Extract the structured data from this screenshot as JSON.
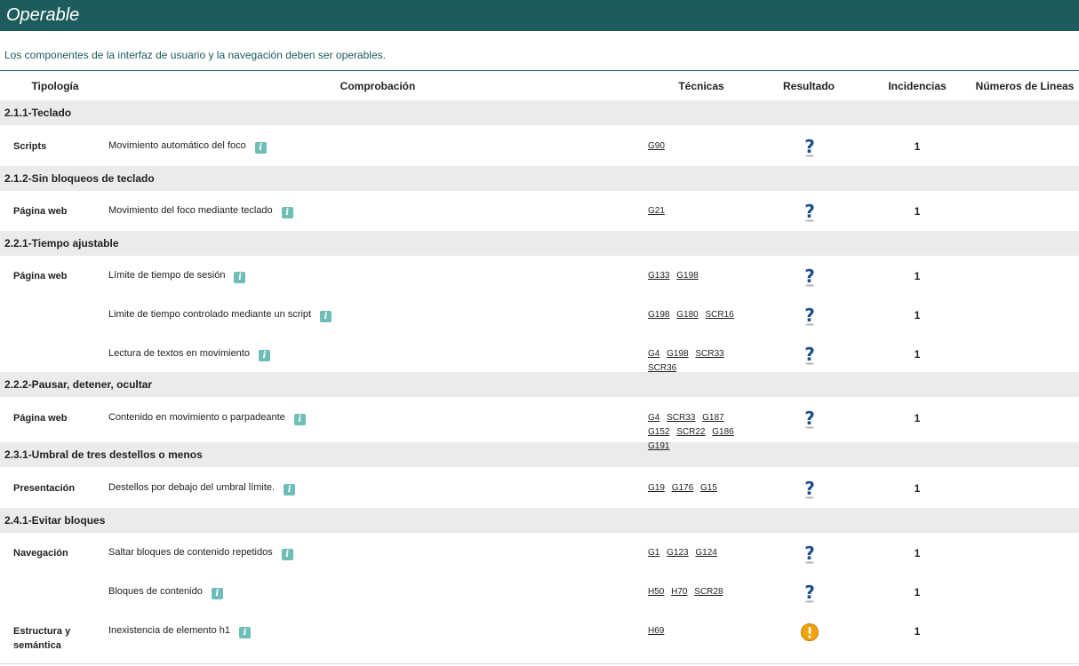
{
  "header": {
    "title": "Operable"
  },
  "intro": "Los componentes de la interfaz de usuario y la navegación deben ser operables.",
  "columns": {
    "tipologia": "Tipología",
    "comprobacion": "Comprobación",
    "tecnicas": "Técnicas",
    "resultado": "Resultado",
    "incidencias": "Incidencias",
    "lineas": "Números de Lineas"
  },
  "groups": [
    {
      "title": "2.1.1-Teclado"
    },
    {
      "title": "2.1.2-Sin bloqueos de teclado"
    },
    {
      "title": "2.2.1-Tiempo ajustable"
    },
    {
      "title": "2.2.2-Pausar, detener, ocultar"
    },
    {
      "title": "2.3.1-Umbral de tres destellos o menos"
    },
    {
      "title": "2.4.1-Evitar bloques"
    }
  ],
  "rows": [
    {
      "tipologia": "Scripts",
      "check": "Movimiento automático del foco",
      "techniques": [
        "G90"
      ],
      "result": "question",
      "incidencias": "1"
    },
    {
      "tipologia": "Página web",
      "check": "Movimiento del foco mediante teclado",
      "techniques": [
        "G21"
      ],
      "result": "question",
      "incidencias": "1"
    },
    {
      "tipologia": "Página web",
      "check": "Límite de tiempo de sesión",
      "techniques": [
        "G133",
        "G198"
      ],
      "result": "question",
      "incidencias": "1"
    },
    {
      "tipologia": "",
      "check": "Limite de tiempo controlado mediante un script",
      "techniques": [
        "G198",
        "G180",
        "SCR16"
      ],
      "result": "question",
      "incidencias": "1"
    },
    {
      "tipologia": "",
      "check": "Lectura de textos en movimiento",
      "techniques": [
        "G4",
        "G198",
        "SCR33",
        "SCR36"
      ],
      "result": "question",
      "incidencias": "1"
    },
    {
      "tipologia": "Página web",
      "check": "Contenido en movimiento o parpadeante",
      "techniques": [
        "G4",
        "SCR33",
        "G187",
        "G152",
        "SCR22",
        "G186",
        "G191"
      ],
      "result": "question",
      "incidencias": "1"
    },
    {
      "tipologia": "Presentación",
      "check": "Destellos por debajo del umbral límite.",
      "techniques": [
        "G19",
        "G176",
        "G15"
      ],
      "result": "question",
      "incidencias": "1"
    },
    {
      "tipologia": "Navegación",
      "check": "Saltar bloques de contenido repetidos",
      "techniques": [
        "G1",
        "G123",
        "G124"
      ],
      "result": "question",
      "incidencias": "1"
    },
    {
      "tipologia": "",
      "check": "Bloques de contenido",
      "techniques": [
        "H50",
        "H70",
        "SCR28"
      ],
      "result": "question",
      "incidencias": "1"
    },
    {
      "tipologia": "Estructura y semántica",
      "check": "Inexistencia de elemento h1",
      "techniques": [
        "H69"
      ],
      "result": "warning",
      "incidencias": "1"
    }
  ],
  "icons": {
    "info": "info-icon",
    "question": "question-mark-icon",
    "warning": "warning-icon"
  },
  "colors": {
    "header": "#1d5c5c",
    "group": "#ebebeb",
    "info": "#6fbdb8",
    "question": "#1c4f8c",
    "warning": "#f0a30a"
  }
}
